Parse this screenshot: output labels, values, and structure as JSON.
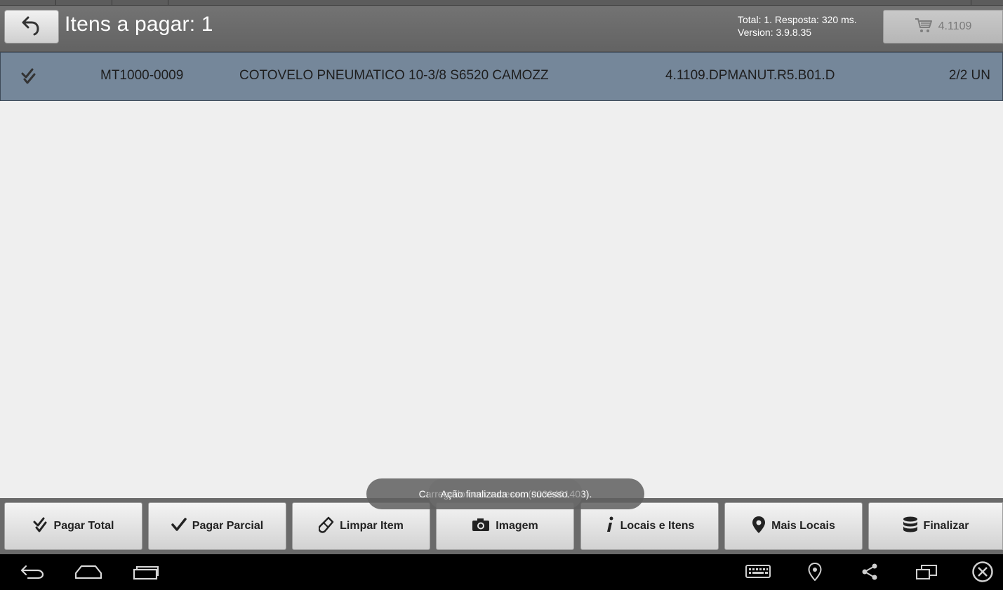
{
  "header": {
    "title": "Itens a pagar: 1",
    "info_line1": "Total: 1. Resposta: 320 ms.",
    "info_line2": "Version: 3.9.8.35",
    "cart_label": "4.1109"
  },
  "list": {
    "rows": [
      {
        "code": "MT1000-0009",
        "description": "COTOVELO PNEUMATICO 10-3/8 S6520 CAMOZZ",
        "location": "4.1109.DPMANUT.R5.B01.D",
        "quantity": "2/2 UN"
      }
    ]
  },
  "toast": {
    "message": "Carregado com sucesso (0030461403).",
    "overlay_message": "Ação finalizada com sucesso."
  },
  "actions": [
    {
      "label": "Pagar Total",
      "icon": "double-check-icon"
    },
    {
      "label": "Pagar Parcial",
      "icon": "check-icon"
    },
    {
      "label": "Limpar Item",
      "icon": "eraser-icon"
    },
    {
      "label": "Imagem",
      "icon": "camera-icon"
    },
    {
      "label": "Locais e Itens",
      "icon": "info-icon"
    },
    {
      "label": "Mais Locais",
      "icon": "map-pin-icon"
    },
    {
      "label": "Finalizar",
      "icon": "database-icon"
    }
  ],
  "colors": {
    "header_bg": "#6b6b6b",
    "row_bg": "#75879a",
    "body_bg": "#efefef",
    "navbar_bg": "#000000"
  }
}
